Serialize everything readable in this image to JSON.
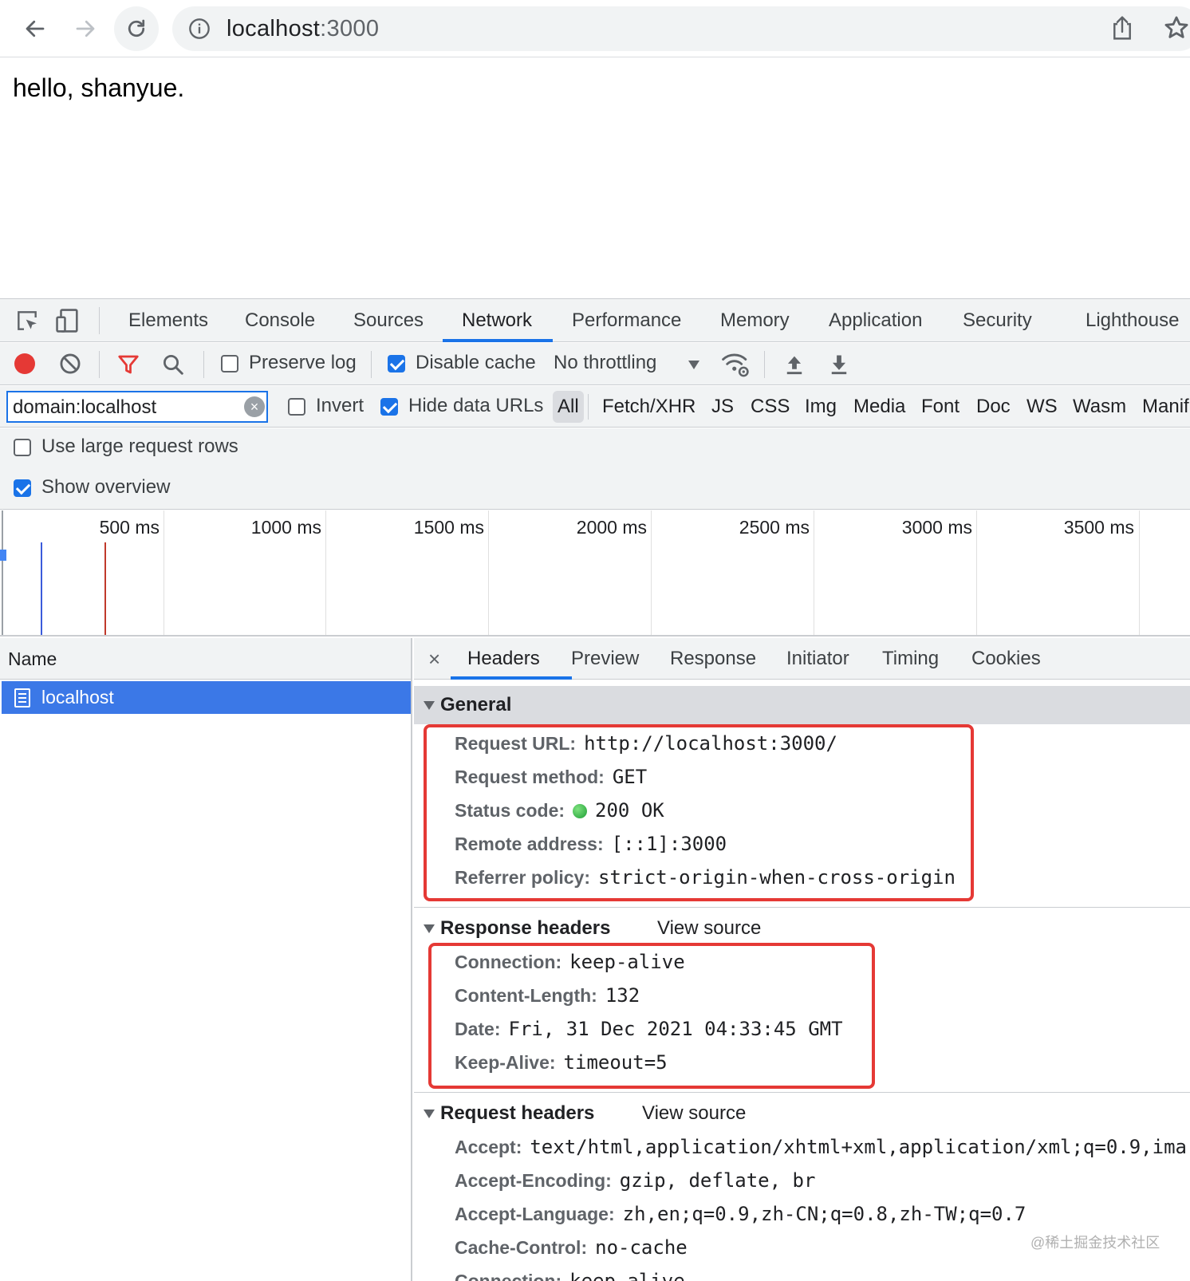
{
  "browser": {
    "url_host": "localhost",
    "url_port": ":3000"
  },
  "page": {
    "text": "hello, shanyue."
  },
  "devtools": {
    "tabs": [
      "Elements",
      "Console",
      "Sources",
      "Network",
      "Performance",
      "Memory",
      "Application",
      "Security",
      "Lighthouse"
    ],
    "active_tab": "Network",
    "toolbar": {
      "preserve_log": "Preserve log",
      "preserve_log_checked": false,
      "disable_cache": "Disable cache",
      "disable_cache_checked": true,
      "throttling": "No throttling"
    },
    "filter": {
      "value": "domain:localhost",
      "invert": "Invert",
      "invert_checked": false,
      "hide_data_urls": "Hide data URLs",
      "hide_data_urls_checked": true,
      "types": [
        "All",
        "Fetch/XHR",
        "JS",
        "CSS",
        "Img",
        "Media",
        "Font",
        "Doc",
        "WS",
        "Wasm",
        "Manif"
      ],
      "active_type": "All"
    },
    "options": {
      "large_rows": "Use large request rows",
      "large_rows_checked": false,
      "show_overview": "Show overview",
      "show_overview_checked": true
    },
    "overview": {
      "ticks": [
        "500 ms",
        "1000 ms",
        "1500 ms",
        "2000 ms",
        "2500 ms",
        "3000 ms",
        "3500 ms"
      ]
    },
    "requests": {
      "column": "Name",
      "rows": [
        "localhost"
      ]
    },
    "details": {
      "tabs": [
        "Headers",
        "Preview",
        "Response",
        "Initiator",
        "Timing",
        "Cookies"
      ],
      "active_tab": "Headers",
      "close": "×",
      "view_source": "View source",
      "general": {
        "title": "General",
        "items": [
          {
            "k": "Request URL:",
            "v": "http://localhost:3000/"
          },
          {
            "k": "Request method:",
            "v": "GET"
          },
          {
            "k": "Status code:",
            "v": "200 OK"
          },
          {
            "k": "Remote address:",
            "v": "[::1]:3000"
          },
          {
            "k": "Referrer policy:",
            "v": "strict-origin-when-cross-origin"
          }
        ]
      },
      "response_headers": {
        "title": "Response headers",
        "items": [
          {
            "k": "Connection:",
            "v": "keep-alive"
          },
          {
            "k": "Content-Length:",
            "v": "132"
          },
          {
            "k": "Date:",
            "v": "Fri, 31 Dec 2021 04:33:45 GMT"
          },
          {
            "k": "Keep-Alive:",
            "v": "timeout=5"
          }
        ]
      },
      "request_headers": {
        "title": "Request headers",
        "items": [
          {
            "k": "Accept:",
            "v": "text/html,application/xhtml+xml,application/xml;q=0.9,ima"
          },
          {
            "k": "Accept-Encoding:",
            "v": "gzip, deflate, br"
          },
          {
            "k": "Accept-Language:",
            "v": "zh,en;q=0.9,zh-CN;q=0.8,zh-TW;q=0.7"
          },
          {
            "k": "Cache-Control:",
            "v": "no-cache"
          },
          {
            "k": "Connection:",
            "v": "keep-alive"
          }
        ]
      }
    }
  },
  "watermark": "@稀土掘金技术社区"
}
